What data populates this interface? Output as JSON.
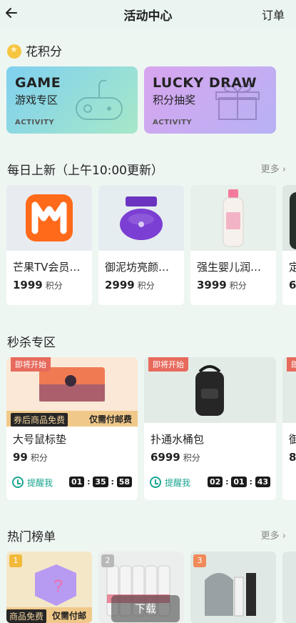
{
  "header": {
    "title": "活动中心",
    "orders": "订单"
  },
  "points_section": {
    "title": "花积分"
  },
  "activities": [
    {
      "big": "GAME",
      "sub": "游戏专区",
      "tag": "ACTIVITY",
      "color_from": "#7fd0f0",
      "color_to": "#a7e8c8"
    },
    {
      "big": "LUCKY DRAW",
      "sub": "积分抽奖",
      "tag": "ACTIVITY",
      "color_from": "#d8a5ef",
      "color_to": "#b7b2f4"
    }
  ],
  "daily": {
    "title": "每日上新（上午10:00更新）",
    "more": "更多",
    "items": [
      {
        "name": "芒果TV会员…",
        "points": "1999",
        "unit": "积分"
      },
      {
        "name": "御泥坊亮颜…",
        "points": "2999",
        "unit": "积分"
      },
      {
        "name": "强生婴儿润…",
        "points": "3999",
        "unit": "积分"
      },
      {
        "name": "定",
        "points": "6",
        "unit": ""
      }
    ]
  },
  "flash": {
    "title": "秒杀专区",
    "items": [
      {
        "tag": "即将开始",
        "strip_a": "券后商品免费",
        "strip_b": "仅需付邮费",
        "name": "大号鼠标垫",
        "points": "99",
        "unit": "积分",
        "remind": "提醒我",
        "t1": "01",
        "t2": "35",
        "t3": "58"
      },
      {
        "tag": "即将开始",
        "name": "扑通水桶包",
        "points": "6999",
        "unit": "积分",
        "remind": "提醒我",
        "t1": "02",
        "t2": "01",
        "t3": "43"
      },
      {
        "tag": "即",
        "name": "御",
        "points": "8",
        "unit": ""
      }
    ]
  },
  "hot": {
    "title": "热门榜单",
    "more": "更多",
    "items": [
      {
        "rank": "1",
        "strip_a": "商品免费",
        "strip_b": "仅需付邮"
      },
      {
        "rank": "2"
      },
      {
        "rank": "3"
      }
    ]
  },
  "download": "下载"
}
